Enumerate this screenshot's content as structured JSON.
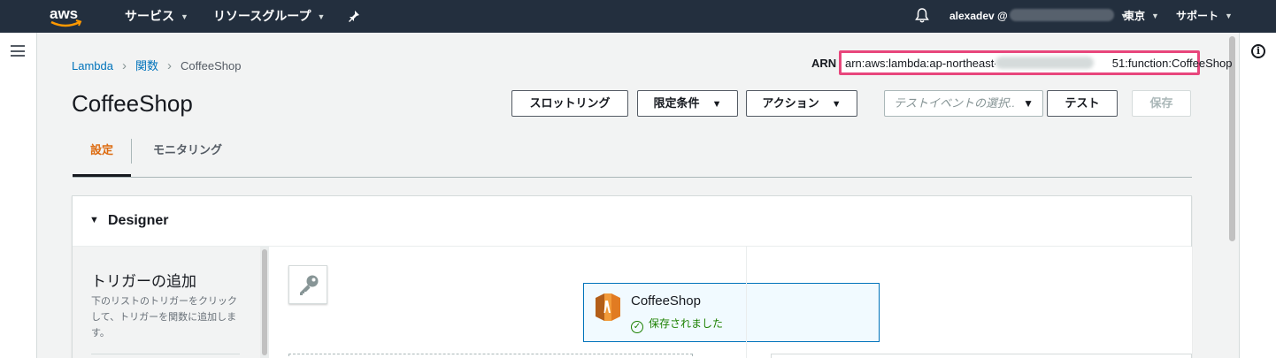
{
  "nav": {
    "logo": "aws",
    "services": "サービス",
    "resource_groups": "リソースグループ",
    "user": "alexadev @",
    "region": "東京",
    "support": "サポート"
  },
  "breadcrumb": {
    "items": [
      "Lambda",
      "関数"
    ],
    "current": "CoffeeShop"
  },
  "arn": {
    "label": "ARN -",
    "value": "arn:aws:lambda:ap-northeast-1:4",
    "value_suffix": "51:function:CoffeeShop"
  },
  "page": {
    "title": "CoffeeShop"
  },
  "toolbar": {
    "throttle": "スロットリング",
    "qualifiers": "限定条件",
    "actions": "アクション",
    "test_event_placeholder": "テストイベントの選択..",
    "test": "テスト",
    "save": "保存"
  },
  "tabs": {
    "config": "設定",
    "monitoring": "モニタリング"
  },
  "designer": {
    "title": "Designer",
    "add_trigger_title": "トリガーの追加",
    "add_trigger_desc": "下のリストのトリガーをクリックして、トリガーを関数に追加します。",
    "function_name": "CoffeeShop",
    "function_status": "保存されました"
  },
  "colors": {
    "nav_bg": "#232f3e",
    "accent_orange": "#dd6b10",
    "link_blue": "#0073bb",
    "arn_highlight": "#e8467c",
    "success_green": "#1d8102"
  }
}
